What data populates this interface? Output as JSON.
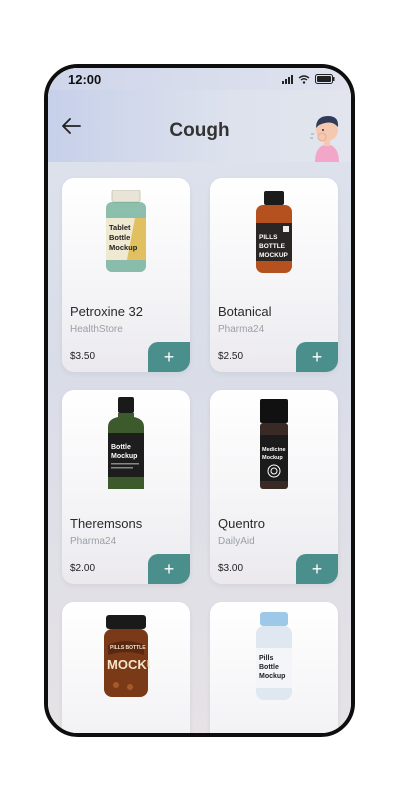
{
  "status_bar": {
    "time": "12:00"
  },
  "header": {
    "title": "Cough"
  },
  "products": [
    {
      "name": "Petroxine 32",
      "store": "HealthStore",
      "price": "$3.50",
      "label": [
        "Tablet",
        "Bottle",
        "Mockup"
      ]
    },
    {
      "name": "Botanical",
      "store": "Pharma24",
      "price": "$2.50",
      "label": [
        "PILLS",
        "BOTTLE",
        "MOCKUP"
      ]
    },
    {
      "name": "Theremsons",
      "store": "Pharma24",
      "price": "$2.00",
      "label": [
        "Bottle",
        "Mockup"
      ]
    },
    {
      "name": "Quentro",
      "store": "DailyAid",
      "price": "$3.00",
      "label": [
        "Medicine",
        "Mockup"
      ]
    },
    {
      "name": "",
      "store": "",
      "price": "",
      "label": [
        "PILLS BOTTLE",
        "MOCKU"
      ]
    },
    {
      "name": "",
      "store": "",
      "price": "",
      "label": [
        "Pills",
        "Bottle",
        "Mockup"
      ]
    }
  ],
  "colors": {
    "accent": "#4a8f8c"
  },
  "icons": {
    "back": "arrow-left-icon",
    "add": "plus-icon",
    "avatar": "coughing-person-avatar"
  }
}
